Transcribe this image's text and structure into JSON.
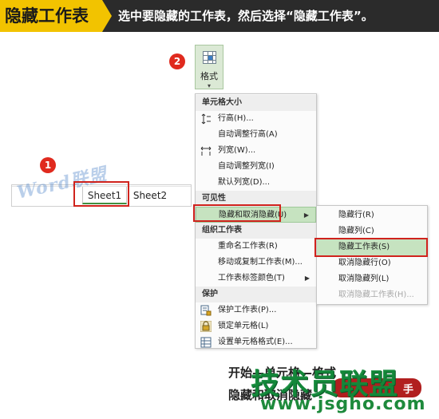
{
  "banner": {
    "title": "隐藏工作表",
    "description": "选中要隐藏的工作表，然后选择“隐藏工作表”。"
  },
  "steps": {
    "step1": "1",
    "step2": "2"
  },
  "sheet_tabs": [
    "Sheet1",
    "Sheet2"
  ],
  "watermark": "Word联盟",
  "format_button": {
    "label": "格式",
    "caret": "▾"
  },
  "menu": {
    "cell_size_header": "单元格大小",
    "row_height": "行高(H)...",
    "autofit_row": "自动调整行高(A)",
    "column_width": "列宽(W)...",
    "autofit_column": "自动调整列宽(I)",
    "default_width": "默认列宽(D)...",
    "visibility_header": "可见性",
    "hide_unhide": "隐藏和取消隐藏(U)",
    "organize_header": "组织工作表",
    "rename_sheet": "重命名工作表(R)",
    "move_copy_sheet": "移动或复制工作表(M)...",
    "tab_color": "工作表标签颜色(T)",
    "protection_header": "保护",
    "protect_sheet": "保护工作表(P)...",
    "lock_cell": "锁定单元格(L)",
    "format_cells": "设置单元格格式(E)..."
  },
  "submenu": {
    "hide_rows": "隐藏行(R)",
    "hide_columns": "隐藏列(C)",
    "hide_sheet": "隐藏工作表(S)",
    "unhide_rows": "取消隐藏行(O)",
    "unhide_columns": "取消隐藏列(L)",
    "unhide_sheet": "取消隐藏工作表(H)..."
  },
  "footer": {
    "line1": "开始—单元格—格式",
    "line2": "隐藏和取消隐藏",
    "brand": "技术员联盟",
    "chip": "手",
    "url": "www.jsgho.com"
  },
  "colors": {
    "accent_yellow": "#f2c300",
    "highlight_red": "#d0231d",
    "menu_active_green": "#c6e3c0"
  }
}
